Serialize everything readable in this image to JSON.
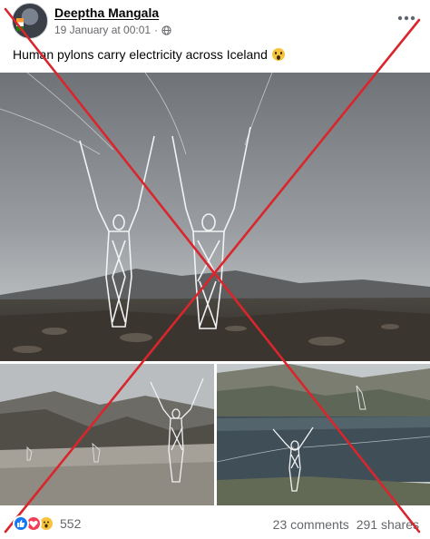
{
  "post": {
    "author": "Deeptha Mangala",
    "timestamp": "19 January at 00:01",
    "separator": "·",
    "caption": "Human pylons carry electricity across Iceland",
    "reaction_count": "552",
    "comments": "23 comments",
    "shares": "291 shares"
  },
  "icons": [
    "avatar",
    "globe-icon",
    "more-options-icon",
    "wow-emoji",
    "like-reaction-icon",
    "love-reaction-icon",
    "wow-reaction-icon"
  ],
  "colors": {
    "like": "#1877f2",
    "love": "#f33e58",
    "wow": "#f7c33c",
    "cross": "#d9262c",
    "meta_text": "#65676b"
  }
}
